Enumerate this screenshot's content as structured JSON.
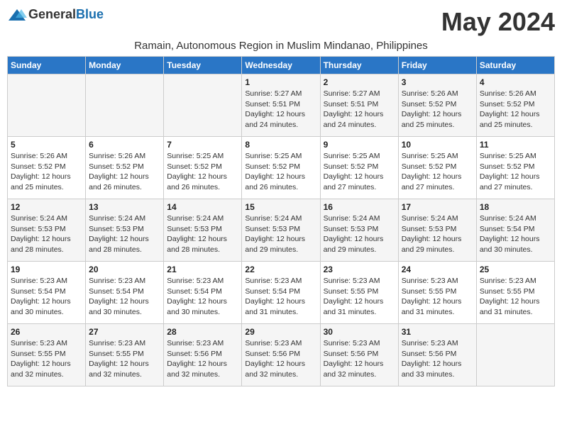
{
  "header": {
    "logo_general": "General",
    "logo_blue": "Blue",
    "month_title": "May 2024",
    "subtitle": "Ramain, Autonomous Region in Muslim Mindanao, Philippines"
  },
  "weekdays": [
    "Sunday",
    "Monday",
    "Tuesday",
    "Wednesday",
    "Thursday",
    "Friday",
    "Saturday"
  ],
  "weeks": [
    [
      {
        "day": "",
        "info": ""
      },
      {
        "day": "",
        "info": ""
      },
      {
        "day": "",
        "info": ""
      },
      {
        "day": "1",
        "info": "Sunrise: 5:27 AM\nSunset: 5:51 PM\nDaylight: 12 hours\nand 24 minutes."
      },
      {
        "day": "2",
        "info": "Sunrise: 5:27 AM\nSunset: 5:51 PM\nDaylight: 12 hours\nand 24 minutes."
      },
      {
        "day": "3",
        "info": "Sunrise: 5:26 AM\nSunset: 5:52 PM\nDaylight: 12 hours\nand 25 minutes."
      },
      {
        "day": "4",
        "info": "Sunrise: 5:26 AM\nSunset: 5:52 PM\nDaylight: 12 hours\nand 25 minutes."
      }
    ],
    [
      {
        "day": "5",
        "info": "Sunrise: 5:26 AM\nSunset: 5:52 PM\nDaylight: 12 hours\nand 25 minutes."
      },
      {
        "day": "6",
        "info": "Sunrise: 5:26 AM\nSunset: 5:52 PM\nDaylight: 12 hours\nand 26 minutes."
      },
      {
        "day": "7",
        "info": "Sunrise: 5:25 AM\nSunset: 5:52 PM\nDaylight: 12 hours\nand 26 minutes."
      },
      {
        "day": "8",
        "info": "Sunrise: 5:25 AM\nSunset: 5:52 PM\nDaylight: 12 hours\nand 26 minutes."
      },
      {
        "day": "9",
        "info": "Sunrise: 5:25 AM\nSunset: 5:52 PM\nDaylight: 12 hours\nand 27 minutes."
      },
      {
        "day": "10",
        "info": "Sunrise: 5:25 AM\nSunset: 5:52 PM\nDaylight: 12 hours\nand 27 minutes."
      },
      {
        "day": "11",
        "info": "Sunrise: 5:25 AM\nSunset: 5:52 PM\nDaylight: 12 hours\nand 27 minutes."
      }
    ],
    [
      {
        "day": "12",
        "info": "Sunrise: 5:24 AM\nSunset: 5:53 PM\nDaylight: 12 hours\nand 28 minutes."
      },
      {
        "day": "13",
        "info": "Sunrise: 5:24 AM\nSunset: 5:53 PM\nDaylight: 12 hours\nand 28 minutes."
      },
      {
        "day": "14",
        "info": "Sunrise: 5:24 AM\nSunset: 5:53 PM\nDaylight: 12 hours\nand 28 minutes."
      },
      {
        "day": "15",
        "info": "Sunrise: 5:24 AM\nSunset: 5:53 PM\nDaylight: 12 hours\nand 29 minutes."
      },
      {
        "day": "16",
        "info": "Sunrise: 5:24 AM\nSunset: 5:53 PM\nDaylight: 12 hours\nand 29 minutes."
      },
      {
        "day": "17",
        "info": "Sunrise: 5:24 AM\nSunset: 5:53 PM\nDaylight: 12 hours\nand 29 minutes."
      },
      {
        "day": "18",
        "info": "Sunrise: 5:24 AM\nSunset: 5:54 PM\nDaylight: 12 hours\nand 30 minutes."
      }
    ],
    [
      {
        "day": "19",
        "info": "Sunrise: 5:23 AM\nSunset: 5:54 PM\nDaylight: 12 hours\nand 30 minutes."
      },
      {
        "day": "20",
        "info": "Sunrise: 5:23 AM\nSunset: 5:54 PM\nDaylight: 12 hours\nand 30 minutes."
      },
      {
        "day": "21",
        "info": "Sunrise: 5:23 AM\nSunset: 5:54 PM\nDaylight: 12 hours\nand 30 minutes."
      },
      {
        "day": "22",
        "info": "Sunrise: 5:23 AM\nSunset: 5:54 PM\nDaylight: 12 hours\nand 31 minutes."
      },
      {
        "day": "23",
        "info": "Sunrise: 5:23 AM\nSunset: 5:55 PM\nDaylight: 12 hours\nand 31 minutes."
      },
      {
        "day": "24",
        "info": "Sunrise: 5:23 AM\nSunset: 5:55 PM\nDaylight: 12 hours\nand 31 minutes."
      },
      {
        "day": "25",
        "info": "Sunrise: 5:23 AM\nSunset: 5:55 PM\nDaylight: 12 hours\nand 31 minutes."
      }
    ],
    [
      {
        "day": "26",
        "info": "Sunrise: 5:23 AM\nSunset: 5:55 PM\nDaylight: 12 hours\nand 32 minutes."
      },
      {
        "day": "27",
        "info": "Sunrise: 5:23 AM\nSunset: 5:55 PM\nDaylight: 12 hours\nand 32 minutes."
      },
      {
        "day": "28",
        "info": "Sunrise: 5:23 AM\nSunset: 5:56 PM\nDaylight: 12 hours\nand 32 minutes."
      },
      {
        "day": "29",
        "info": "Sunrise: 5:23 AM\nSunset: 5:56 PM\nDaylight: 12 hours\nand 32 minutes."
      },
      {
        "day": "30",
        "info": "Sunrise: 5:23 AM\nSunset: 5:56 PM\nDaylight: 12 hours\nand 32 minutes."
      },
      {
        "day": "31",
        "info": "Sunrise: 5:23 AM\nSunset: 5:56 PM\nDaylight: 12 hours\nand 33 minutes."
      },
      {
        "day": "",
        "info": ""
      }
    ]
  ]
}
